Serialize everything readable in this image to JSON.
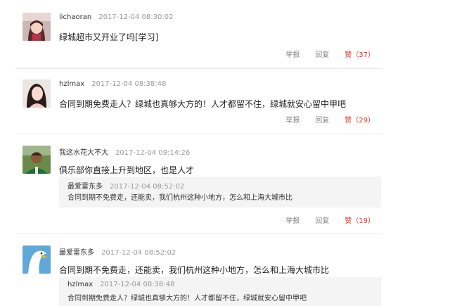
{
  "comments": [
    {
      "username": "lichaoran",
      "time": "2017-12-04 08:30:02",
      "text": "绿城超市又开业了吗[学习]",
      "report": "举报",
      "reply": "回复",
      "like": "赞（37）"
    },
    {
      "username": "hzlmax",
      "time": "2017-12-04 08:38:48",
      "text": "合同到期免费走人？绿城也真够大方的！人才都留不住，绿城就安心留中甲吧",
      "report": "举报",
      "reply": "回复",
      "like": "赞（29）"
    },
    {
      "username": "我这水花大不大",
      "time": "2017-12-04 09:14:26",
      "text": "俱乐部你直接上升到地区，也是人才",
      "quote": {
        "username": "最爱雷东多",
        "time": "2017-12-04 08:52:02",
        "text": "合同到期不免费走，还能卖，我们杭州这种小地方，怎么和上海大城市比"
      },
      "report": "举报",
      "reply": "回复",
      "like": "赞（19）"
    },
    {
      "username": "最爱雷东多",
      "time": "2017-12-04 08:52:02",
      "text": "合同到期不免费走，还能卖，我们杭州这种小地方，怎么和上海大城市比",
      "quote": {
        "username": "hzlmax",
        "time": "2017-12-04 08:38:48",
        "text": "合同到期免费走人？绿城也真够大方的！人才都留不住，绿城就安心留中甲吧"
      }
    }
  ],
  "colors": {
    "like": "#e0352b",
    "muted": "#999999",
    "quote_bg": "#f4f4f4"
  }
}
